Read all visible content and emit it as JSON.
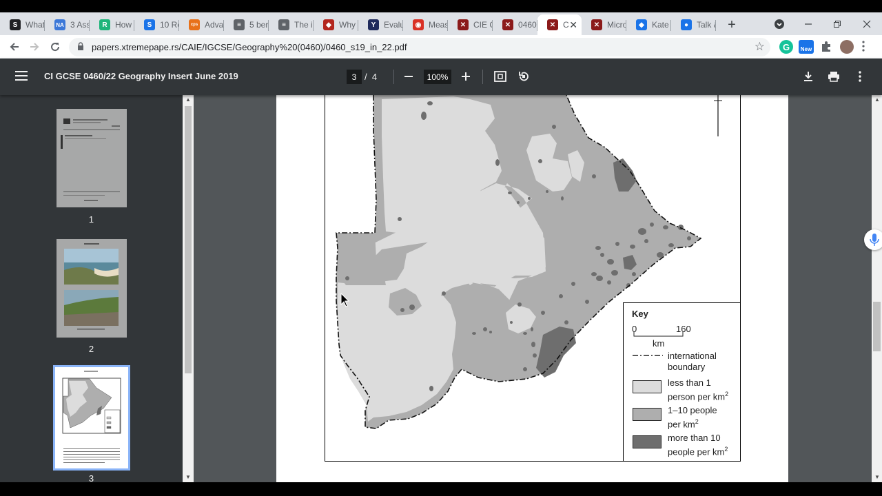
{
  "tabs": [
    {
      "label": "What",
      "icon": "s-icon",
      "color": "#202124"
    },
    {
      "label": "3 Ass",
      "icon": "na-icon",
      "color": "#3c78d8"
    },
    {
      "label": "How",
      "icon": "r-icon",
      "color": "#1fb57a"
    },
    {
      "label": "10 Re",
      "icon": "swirl-icon",
      "color": "#1a73e8"
    },
    {
      "label": "Adva",
      "icon": "cps-icon",
      "color": "#e8711a"
    },
    {
      "label": "5 ber",
      "icon": "doc-icon",
      "color": "#5f6368"
    },
    {
      "label": "The ir",
      "icon": "doc-icon",
      "color": "#5f6368"
    },
    {
      "label": "Why",
      "icon": "shield-icon",
      "color": "#b3261e"
    },
    {
      "label": "Evalu",
      "icon": "y-icon",
      "color": "#1f2a5c"
    },
    {
      "label": "Meas",
      "icon": "circle-icon",
      "color": "#d93025"
    },
    {
      "label": "CIE G",
      "icon": "xp-icon",
      "color": "#8b1a1a"
    },
    {
      "label": "0460",
      "icon": "xp-icon",
      "color": "#8b1a1a"
    },
    {
      "label": "C",
      "icon": "xp-icon",
      "color": "#8b1a1a",
      "active": true
    },
    {
      "label": "Micro",
      "icon": "xp-icon",
      "color": "#8b1a1a"
    },
    {
      "label": "Kate",
      "icon": "cap-icon",
      "color": "#1a73e8"
    },
    {
      "label": "Talk &",
      "icon": "mic-icon",
      "color": "#1a73e8"
    }
  ],
  "newtab": "+",
  "address": {
    "url": "papers.xtremepape.rs/CAIE/IGCSE/Geography%20(0460)/0460_s19_in_22.pdf"
  },
  "extensions": {
    "new_badge": "New"
  },
  "pdf": {
    "title": "CI GCSE 0460/22 Geography Insert June 2019",
    "current_page": "3",
    "page_sep": "/",
    "total_pages": "4",
    "zoom": "100%"
  },
  "thumbnails": [
    {
      "number": "1"
    },
    {
      "number": "2"
    },
    {
      "number": "3"
    }
  ],
  "key": {
    "title": "Key",
    "scale_start": "0",
    "scale_end": "160",
    "scale_unit": "km",
    "items": [
      {
        "label": "international",
        "label2": "boundary"
      },
      {
        "label": "less than 1",
        "label2": "person per km",
        "sup": "2",
        "color": "#dcdcdc"
      },
      {
        "label": "1–10 people",
        "label2": "per km",
        "sup": "2",
        "color": "#aeaeae"
      },
      {
        "label": "more than 10",
        "label2": "people per km",
        "sup": "2",
        "color": "#6e6e6e"
      }
    ]
  },
  "colors": {
    "low": "#dcdcdc",
    "mid": "#aeaeae",
    "high": "#6e6e6e",
    "toolbar": "#323639",
    "viewer_bg": "#525659"
  }
}
